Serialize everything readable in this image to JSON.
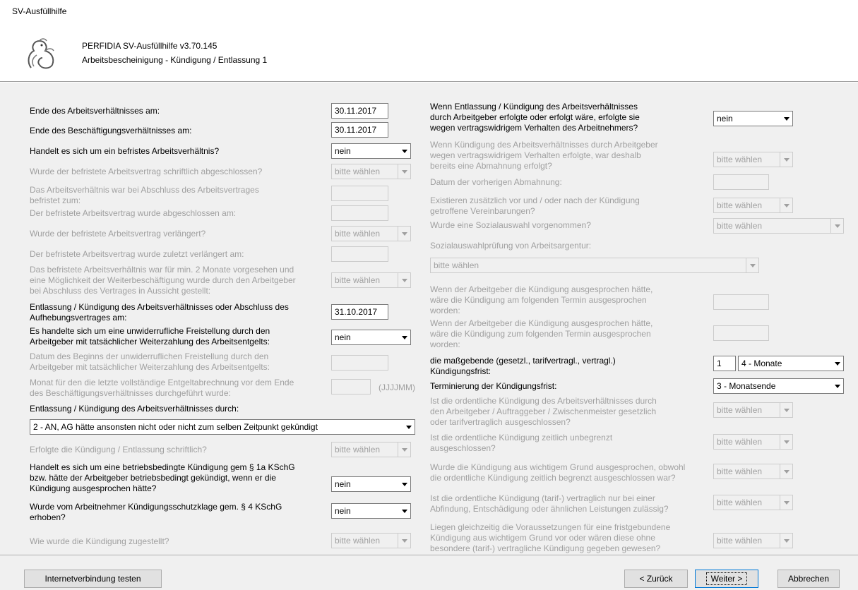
{
  "window": {
    "title": "SV-Ausfüllhilfe"
  },
  "header": {
    "app_version": "PERFIDIA SV-Ausfüllhilfe v3.70.145",
    "section": "Arbeitsbescheinigung - Kündigung / Entlassung 1"
  },
  "left": {
    "ende_arbeitsverhaeltnis": {
      "label": "Ende des Arbeitsverhältnisses am:",
      "value": "30.11.2017"
    },
    "ende_beschaeftigung": {
      "label": "Ende des Beschäftigungsverhältnisses am:",
      "value": "30.11.2017"
    },
    "befristet": {
      "label": "Handelt es sich um ein befristes Arbeitsverhältnis?",
      "value": "nein"
    },
    "schriftlich_abgeschlossen": {
      "label": "Wurde der befristete Arbeitsvertrag schriftlich abgeschlossen?",
      "value": "bitte wählen"
    },
    "befristet_zum": {
      "label1": "Das Arbeitsverhältnis war bei Abschluss des Arbeitsvertrages",
      "label2": "befristet zum:"
    },
    "abgeschlossen_am": {
      "label": "Der befristete Arbeitsvertrag wurde abgeschlossen am:"
    },
    "verlaengert": {
      "label": "Wurde der befristete Arbeitsvertrag verlängert?",
      "value": "bitte wählen"
    },
    "zuletzt_verlaengert": {
      "label": "Der befristete Arbeitsvertrag wurde zuletzt verlängert am:"
    },
    "min_2_monate": {
      "label1": "Das befristete Arbeitsverhältnis war für min. 2 Monate vorgesehen und",
      "label2": "eine Möglichkeit der Weiterbeschäftigung wurde durch den Arbeitgeber",
      "label3": "bei Abschluss des Vertrages in Aussicht gestellt:",
      "value": "bitte wählen"
    },
    "entlassung_abschluss": {
      "label1": "Entlassung / Kündigung des Arbeitsverhältnisses oder Abschluss des",
      "label2": "Aufhebungsvertrages am:",
      "value": "31.10.2017"
    },
    "freistellung": {
      "label1": "Es handelte sich um eine unwiderrufliche Freistellung durch den",
      "label2": "Arbeitgeber mit tatsächlicher Weiterzahlung des Arbeitsentgelts:",
      "value": "nein"
    },
    "freistellung_beginn": {
      "label1": "Datum des Beginns der unwiderruflichen Freistellung durch den",
      "label2": "Arbeitgeber mit tatsächlicher Weiterzahlung des Arbeitsentgelts:"
    },
    "letzte_entgeltabrechnung": {
      "label1": "Monat für den die letzte vollständige Entgeltabrechnung vor dem Ende",
      "label2": "des Beschäftigungsverhältnisses durchgeführt wurde:",
      "hint": "(JJJJMM)"
    },
    "entlassung_durch": {
      "label": "Entlassung / Kündigung des Arbeitsverhältnisses durch:",
      "value": "2 - AN, AG hätte ansonsten nicht oder nicht zum selben Zeitpunkt gekündigt"
    },
    "schriftlich": {
      "label": "Erfolgte die Kündigung / Entlassung schriftlich?",
      "value": "bitte wählen"
    },
    "betriebsbedingt": {
      "label1": "Handelt es sich um eine betriebsbedingte Kündigung gem § 1a KSchG",
      "label2": "bzw. hätte der Arbeitgeber betriebsbedingt gekündigt, wenn er die",
      "label3": "Kündigung ausgesprochen hätte?",
      "value": "nein"
    },
    "klage": {
      "label1": "Wurde vom Arbeitnehmer Kündigungsschutzklage gem. § 4 KSchG",
      "label2": "erhoben?",
      "value": "nein"
    },
    "zugestellt": {
      "label": "Wie wurde die Kündigung zugestellt?",
      "value": "bitte wählen"
    }
  },
  "right": {
    "vertragswidrig": {
      "label1": "Wenn Entlassung / Kündigung des Arbeitsverhältnisses",
      "label2": "durch Arbeitgeber erfolgte oder erfolgt wäre, erfolgte sie",
      "label3": "wegen vertragswidrigem Verhalten des Arbeitnehmers?",
      "value": "nein"
    },
    "abmahnung": {
      "label1": "Wenn Kündigung des Arbeitsverhältnisses durch Arbeitgeber",
      "label2": "wegen vertragswidrigem Verhalten erfolgte, war deshalb",
      "label3": "bereits eine Abmahnung erfolgt?",
      "value": "bitte wählen"
    },
    "abmahnung_datum": {
      "label": "Datum der vorherigen Abmahnung:"
    },
    "vereinbarungen": {
      "label1": "Existieren zusätzlich vor und / oder nach der Kündigung",
      "label2": "getroffene Vereinbarungen?",
      "value": "bitte wählen"
    },
    "sozialauswahl": {
      "label": "Wurde eine Sozialauswahl vorgenommen?",
      "value": "bitte wählen"
    },
    "sozialpruefung": {
      "label": "Sozialauswahlprüfung von Arbeitsargentur:",
      "value": "bitte wählen"
    },
    "termin_am": {
      "label1": "Wenn der Arbeitgeber die Kündigung ausgesprochen hätte,",
      "label2": "wäre die Kündigung am folgenden Termin ausgesprochen",
      "label3": "worden:"
    },
    "termin_zum": {
      "label1": "Wenn der Arbeitgeber die Kündigung ausgesprochen hätte,",
      "label2": "wäre die Kündigung zum folgenden Termin ausgesprochen",
      "label3": "worden:"
    },
    "kuendigungsfrist": {
      "label1": "die maßgebende (gesetzl., tarifvertragl., vertragl.)",
      "label2": "Kündigungsfrist:",
      "number": "1",
      "unit": "4 - Monate"
    },
    "terminierung": {
      "label": "Terminierung der Kündigungsfrist:",
      "value": "3 - Monatsende"
    },
    "ordentlich_ausgeschlossen": {
      "label1": "Ist die ordentliche Kündigung des Arbeitsverhältnisses durch",
      "label2": "den Arbeitgeber / Auftraggeber / Zwischenmeister gesetzlich",
      "label3": "oder tarifvertraglich ausgeschlossen?",
      "value": "bitte wählen"
    },
    "unbegrenzt": {
      "label1": "Ist die ordentliche Kündigung zeitlich unbegrenzt",
      "label2": "ausgeschlossen?",
      "value": "bitte wählen"
    },
    "wichtiger_grund": {
      "label1": "Wurde die Kündigung aus wichtigem Grund ausgesprochen, obwohl",
      "label2": "die ordentliche Kündigung zeitlich begrenzt ausgeschlossen war?",
      "value": "bitte wählen"
    },
    "abfindung": {
      "label1": "Ist die ordentliche Kündigung (tarif-) vertraglich nur bei einer",
      "label2": "Abfindung, Entschädigung oder ähnlichen Leistungen zulässig?",
      "value": "bitte wählen"
    },
    "fristgebunden": {
      "label1": "Liegen gleichzeitig die Voraussetzungen für eine fristgebundene",
      "label2": "Kündigung aus wichtigem Grund vor oder wären diese ohne",
      "label3": "besondere (tarif-) vertragliche Kündigung gegeben gewesen?",
      "value": "bitte wählen"
    }
  },
  "footer": {
    "test_connection": "Internetverbindung testen",
    "back": "< Zurück",
    "next": "Weiter >",
    "cancel": "Abbrechen"
  }
}
